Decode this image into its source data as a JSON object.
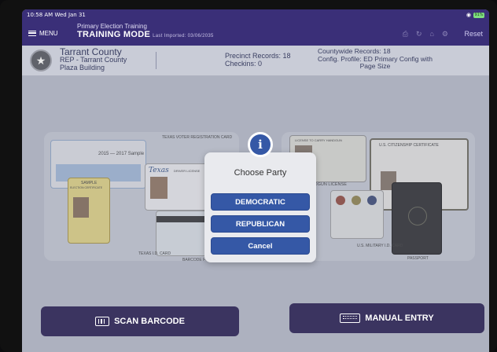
{
  "status": {
    "time": "10:58 AM  Wed Jan 31",
    "wifi": "WiFi 91%",
    "battery": "91%"
  },
  "nav": {
    "menu_label": "MENU",
    "title_line1": "Primary Election Training",
    "title_line2": "TRAINING MODE",
    "last_imported": "Last Imported: 03/06/2035",
    "reset_label": "Reset"
  },
  "info": {
    "county": "Tarrant County",
    "rep": "REP - Tarrant County",
    "location": "Plaza Building",
    "precinct_records": "Precinct Records:  18",
    "checkins": "Checkins:  0",
    "countywide_records": "Countywide Records:  18",
    "config_profile": "Config. Profile:  ED Primary Config with",
    "config_profile_2": "Page Size"
  },
  "cards": {
    "voter_reg": "TEXAS VOTER REGISTRATION CARD",
    "sample_year": "2015 — 2017 Sample",
    "texas": "Texas",
    "drivers": "DRIVER LICENSE",
    "election_cert": "ELECTION CERTIFICATE",
    "sample": "SAMPLE",
    "handgun": "LICENSE TO CARRY HANDGUN",
    "handgun2": "HANDGUN LICENSE",
    "citizenship": "U.S. CITIZENSHIP CERTIFICATE",
    "military": "U.S. MILITARY I.D. CARD",
    "passport": "PASSPORT",
    "texas_id": "TEXAS I.D. CARD",
    "barcode_for": "BARCODE FOR"
  },
  "dialog": {
    "icon": "i",
    "title": "Choose Party",
    "btn_democratic": "DEMOCRATIC",
    "btn_republican": "REPUBLICAN",
    "btn_cancel": "Cancel"
  },
  "actions": {
    "scan_barcode": "SCAN BARCODE",
    "manual_entry": "MANUAL ENTRY"
  },
  "colors": {
    "header": "#3a2f78",
    "button_blue": "#3558a6",
    "action_button": "#3b3460"
  }
}
